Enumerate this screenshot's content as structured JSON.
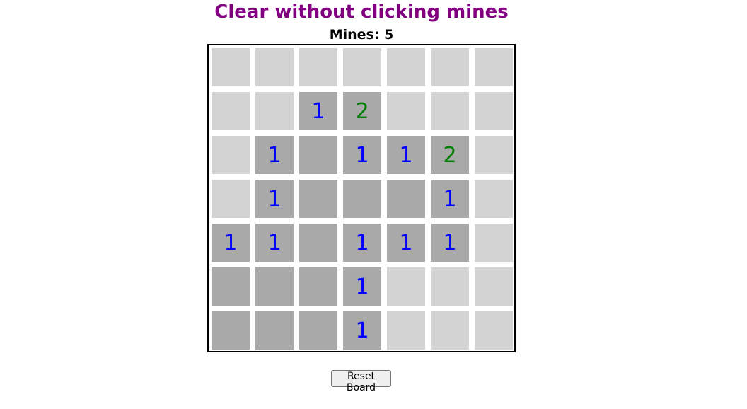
{
  "title": "Clear without clicking mines",
  "mines_label": "Mines: 5",
  "reset_label": "Reset Board",
  "colors": {
    "title": "#800080",
    "hidden": "#d3d3d3",
    "revealed": "#a9a9a9",
    "number_1": "#0000ff",
    "number_2": "#008000"
  },
  "board": {
    "rows": 7,
    "cols": 7,
    "cells": [
      [
        "H",
        "H",
        "H",
        "H",
        "H",
        "H",
        "H"
      ],
      [
        "H",
        "H",
        "1",
        "2",
        "H",
        "H",
        "H"
      ],
      [
        "H",
        "1",
        "0",
        "1",
        "1",
        "2",
        "H"
      ],
      [
        "H",
        "1",
        "0",
        "0",
        "0",
        "1",
        "H"
      ],
      [
        "1",
        "1",
        "0",
        "1",
        "1",
        "1",
        "H"
      ],
      [
        "0",
        "0",
        "0",
        "1",
        "H",
        "H",
        "H"
      ],
      [
        "0",
        "0",
        "0",
        "1",
        "H",
        "H",
        "H"
      ]
    ]
  }
}
